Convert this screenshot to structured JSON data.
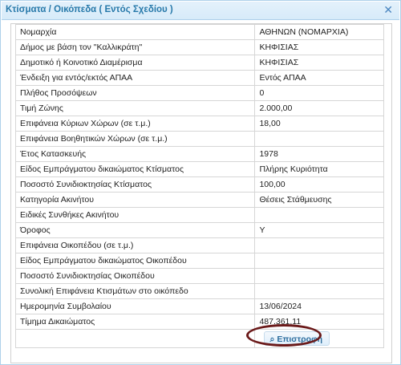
{
  "dialog": {
    "title": "Κτίσματα / Οικόπεδα ( Εντός Σχεδίου )",
    "close_symbol": "✕"
  },
  "rows": [
    {
      "label": "Νομαρχία",
      "value": "ΑΘΗΝΩΝ (ΝΟΜΑΡΧΙΑ)"
    },
    {
      "label": "Δήμος με βάση τον \"Καλλικράτη\"",
      "value": "ΚΗΦΙΣΙΑΣ"
    },
    {
      "label": "Δημοτικό ή Κοινοτικό Διαμέρισμα",
      "value": "ΚΗΦΙΣΙΑΣ"
    },
    {
      "label": "Ένδειξη για εντός/εκτός ΑΠΑΑ",
      "value": "Εντός ΑΠΑΑ"
    },
    {
      "label": "Πλήθος Προσόψεων",
      "value": "0"
    },
    {
      "label": "Τιμή Ζώνης",
      "value": "2.000,00"
    },
    {
      "label": "Επιφάνεια Κύριων Χώρων (σε τ.μ.)",
      "value": "18,00"
    },
    {
      "label": "Επιφάνεια Βοηθητικών Χώρων (σε τ.μ.)",
      "value": ""
    },
    {
      "label": "Έτος Κατασκευής",
      "value": "1978"
    },
    {
      "label": "Είδος Εμπράγματου δικαιώματος Κτίσματος",
      "value": "Πλήρης Κυριότητα"
    },
    {
      "label": "Ποσοστό Συνιδιοκτησίας Κτίσματος",
      "value": "100,00"
    },
    {
      "label": "Κατηγορία Ακινήτου",
      "value": "Θέσεις Στάθμευσης"
    },
    {
      "label": "Ειδικές Συνθήκες Ακινήτου",
      "value": ""
    },
    {
      "label": "Όροφος",
      "value": "Υ"
    },
    {
      "label": "Επιφάνεια Οικοπέδου (σε τ.μ.)",
      "value": ""
    },
    {
      "label": "Είδος Εμπράγματου δικαιώματος Οικοπέδου",
      "value": ""
    },
    {
      "label": "Ποσοστό Συνιδιοκτησίας Οικοπέδου",
      "value": ""
    },
    {
      "label": "Συνολική Επιφάνεια Κτισμάτων στο οικόπεδο",
      "value": ""
    },
    {
      "label": "Ημερομηνία Συμβολαίου",
      "value": "13/06/2024"
    },
    {
      "label": "Τίμημα Δικαιώματος",
      "value": "487.361,11"
    }
  ],
  "actions": {
    "back_label": "Επιστροφή",
    "back_icon": "search-icon"
  },
  "annotation": {
    "color": "#6b1a1a"
  }
}
